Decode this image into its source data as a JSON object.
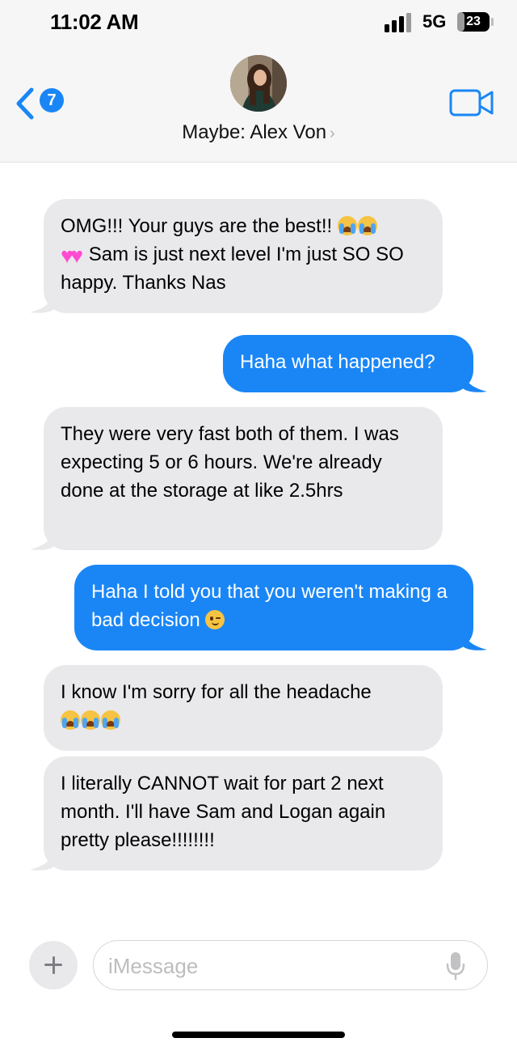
{
  "status_bar": {
    "time": "11:02 AM",
    "network": "5G",
    "battery": "23",
    "battery_percent": 23
  },
  "header": {
    "back_badge": "7",
    "contact_name": "Maybe: Alex Von",
    "icons": {
      "back": "chevron-left-icon",
      "video": "video-camera-icon",
      "contact": "chevron-right-icon"
    }
  },
  "messages": [
    {
      "direction": "incoming",
      "parts": [
        "OMG!!! Your guys are the best!! ",
        "😭😭",
        " ",
        "💗💗",
        " Sam is just next level I'm just SO SO happy. Thanks Nas"
      ]
    },
    {
      "direction": "outgoing",
      "text": "Haha what happened?"
    },
    {
      "direction": "incoming",
      "text": "They were very fast both of them. I was expecting 5 or 6 hours. We're already done at the storage at like 2.5hrs"
    },
    {
      "direction": "outgoing",
      "parts": [
        "Haha I told you that you weren't making a bad decision ",
        "😉"
      ]
    },
    {
      "direction": "incoming",
      "parts": [
        "I know I'm sorry for all the headache ",
        "😭😭😭"
      ]
    },
    {
      "direction": "incoming",
      "text": "I literally CANNOT wait for part 2 next month. I'll have Sam and Logan again pretty please!!!!!!!!"
    }
  ],
  "composer": {
    "placeholder": "iMessage",
    "icons": {
      "add": "plus-icon",
      "mic": "microphone-icon"
    }
  },
  "colors": {
    "outgoing_bubble": "#1a86f6",
    "incoming_bubble": "#e9e9eb",
    "header_background": "#f6f6f6"
  }
}
